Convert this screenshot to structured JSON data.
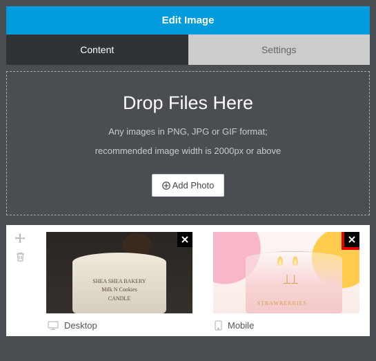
{
  "header": {
    "title": "Edit Image"
  },
  "tabs": {
    "content": "Content",
    "settings": "Settings"
  },
  "dropzone": {
    "title": "Drop Files Here",
    "subtitle": "Any images in PNG, JPG or GIF format;",
    "recommendation": "recommended image width is 2000px or above",
    "add_button": "Add Photo"
  },
  "thumbnails": [
    {
      "label": "Desktop",
      "device": "desktop"
    },
    {
      "label": "Mobile",
      "device": "mobile"
    }
  ]
}
